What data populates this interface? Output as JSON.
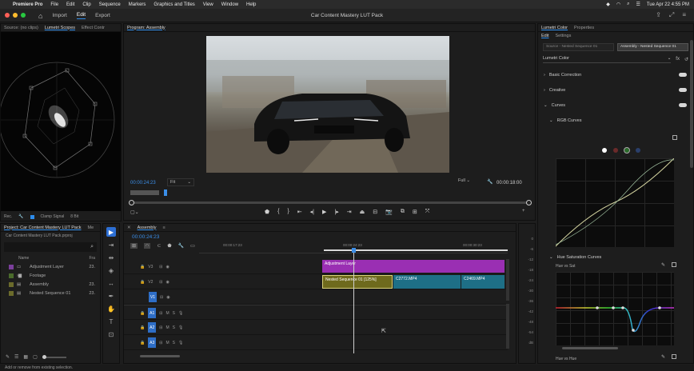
{
  "menubar": {
    "apple": "",
    "app": "Premiere Pro",
    "items": [
      "File",
      "Edit",
      "Clip",
      "Sequence",
      "Markers",
      "Graphics and Titles",
      "View",
      "Window",
      "Help"
    ],
    "datetime": "Tue Apr 22  4:55 PM"
  },
  "header": {
    "tabs": {
      "import": "Import",
      "edit": "Edit",
      "export": "Export"
    },
    "title": "Car Content Mastery LUT Pack"
  },
  "source_panel": {
    "tabs": [
      "Source: (no clips)",
      "Lumetri Scopes",
      "Effect Contr"
    ],
    "bottom": {
      "rec": "Rec.",
      "clamp": "Clamp Signal",
      "bits": "8 Bit"
    }
  },
  "program": {
    "tab": "Program: Assembly",
    "timecode": "00:00:24:23",
    "fit": "Fit",
    "quality": "Full",
    "duration": "00:00:18:00"
  },
  "project": {
    "tabs": [
      "Project: Car Content Mastery LUT Pack",
      "Me"
    ],
    "path": "Car Content Mastery LUT Pack.prproj",
    "col_name": "Name",
    "col_fr": "Fra",
    "items": [
      {
        "name": "Adjustment Layer",
        "fr": "23.",
        "color": "#7b3f9c",
        "indent": 0,
        "icon": "adjustment-icon"
      },
      {
        "name": "Footage",
        "fr": "",
        "color": "#4a6b2b",
        "indent": 0,
        "icon": "folder-icon"
      },
      {
        "name": "Assembly",
        "fr": "23.",
        "color": "#6b6b2b",
        "indent": 0,
        "icon": "sequence-icon"
      },
      {
        "name": "Nested Sequence 01",
        "fr": "23.",
        "color": "#6b6b2b",
        "indent": 0,
        "icon": "sequence-icon"
      }
    ]
  },
  "timeline": {
    "tab": "Assembly",
    "timecode": "00:00:24:23",
    "ruler": [
      "00:00:17:23",
      "00:00:24:23",
      "00:00:30:23"
    ],
    "video_tracks": [
      "V3",
      "V2",
      "V1"
    ],
    "audio_tracks": [
      "A1",
      "A2",
      "A3"
    ],
    "clips": {
      "adjust": "Adjustment Layer",
      "nested": "Nested Sequence 01 [125%]",
      "c1": "C2772.MP4",
      "c2": "C2469.MP4"
    },
    "meter_ticks": [
      "0",
      "-6",
      "-12",
      "-18",
      "-24",
      "-30",
      "-36",
      "-42",
      "-48",
      "-54",
      "dB"
    ]
  },
  "lumetri": {
    "tabs": [
      "Lumetri Color",
      "Properties"
    ],
    "subtabs": [
      "Edit",
      "Settings"
    ],
    "source_btn": "Source - Nested Sequence 01",
    "master_btn": "Assembly - Nested Sequence 01",
    "effect": "Lumetri Color",
    "sections": {
      "basic": "Basic Correction",
      "creative": "Creative",
      "curves": "Curves",
      "rgb": "RGB Curves",
      "hsc": "Hue Saturation Curves",
      "hvs": "Hue vs Sat",
      "hvh": "Hue vs Hue"
    }
  },
  "status": {
    "text": "Add or remove from existing selection."
  }
}
